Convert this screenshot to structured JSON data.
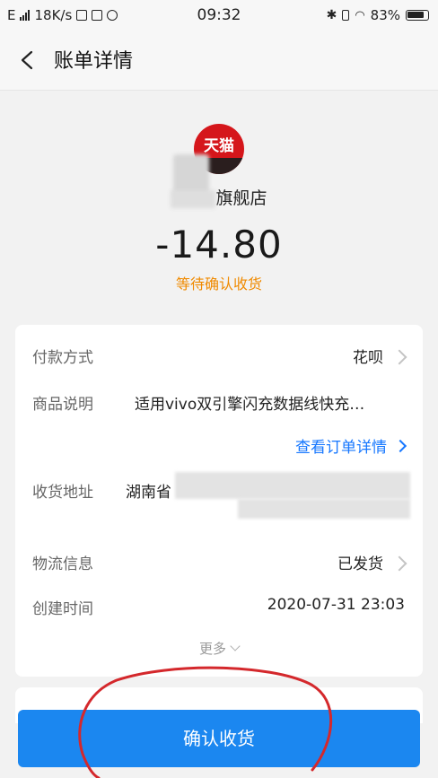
{
  "status_bar": {
    "network": "E",
    "speed": "18K/s",
    "time": "09:32",
    "battery_percent": "83%"
  },
  "header": {
    "title": "账单详情",
    "back_icon": "chevron-left-icon"
  },
  "merchant": {
    "logo_text": "天猫",
    "shop_name_visible": "旗舰店",
    "amount": "-14.80",
    "status": "等待确认收货",
    "status_color": "#f08a00"
  },
  "details": {
    "rows": [
      {
        "label": "付款方式",
        "value": "花呗"
      },
      {
        "label": "商品说明",
        "value": "适用vivo双引擎闪充数据线快充…"
      },
      {
        "label": "收货地址",
        "value": "湖南省"
      },
      {
        "label": "物流信息",
        "value": "已发货"
      },
      {
        "label": "创建时间",
        "value": "2020-07-31 23:03"
      }
    ],
    "order_link": "查看订单详情",
    "more": "更多"
  },
  "action": {
    "confirm_label": "确认收货",
    "button_color": "#1b87f0"
  },
  "annotation_color": "#d4282c"
}
